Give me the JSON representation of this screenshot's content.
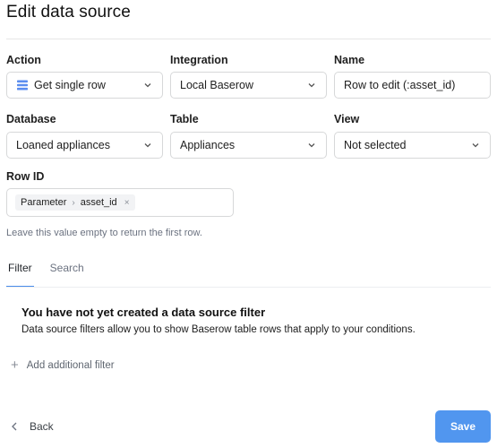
{
  "header": {
    "title": "Edit data source"
  },
  "fields": {
    "action": {
      "label": "Action",
      "value": "Get single row",
      "icon": "table-rows-icon"
    },
    "integration": {
      "label": "Integration",
      "value": "Local Baserow"
    },
    "name": {
      "label": "Name",
      "value": "Row to edit (:asset_id)"
    },
    "database": {
      "label": "Database",
      "value": "Loaned appliances"
    },
    "table": {
      "label": "Table",
      "value": "Appliances"
    },
    "view": {
      "label": "View",
      "value": "Not selected"
    },
    "row_id": {
      "label": "Row ID",
      "chip_parts": [
        "Parameter",
        "asset_id"
      ],
      "hint": "Leave this value empty to return the first row."
    }
  },
  "tabs": [
    "Filter",
    "Search"
  ],
  "filter_empty": {
    "title": "You have not yet created a data source filter",
    "description": "Data source filters allow you to show Baserow table rows that apply to your conditions.",
    "add_label": "Add additional filter"
  },
  "footer": {
    "back_label": "Back",
    "save_label": "Save"
  },
  "colors": {
    "accent": "#5196ef",
    "tab_indicator": "#4a8dea"
  }
}
